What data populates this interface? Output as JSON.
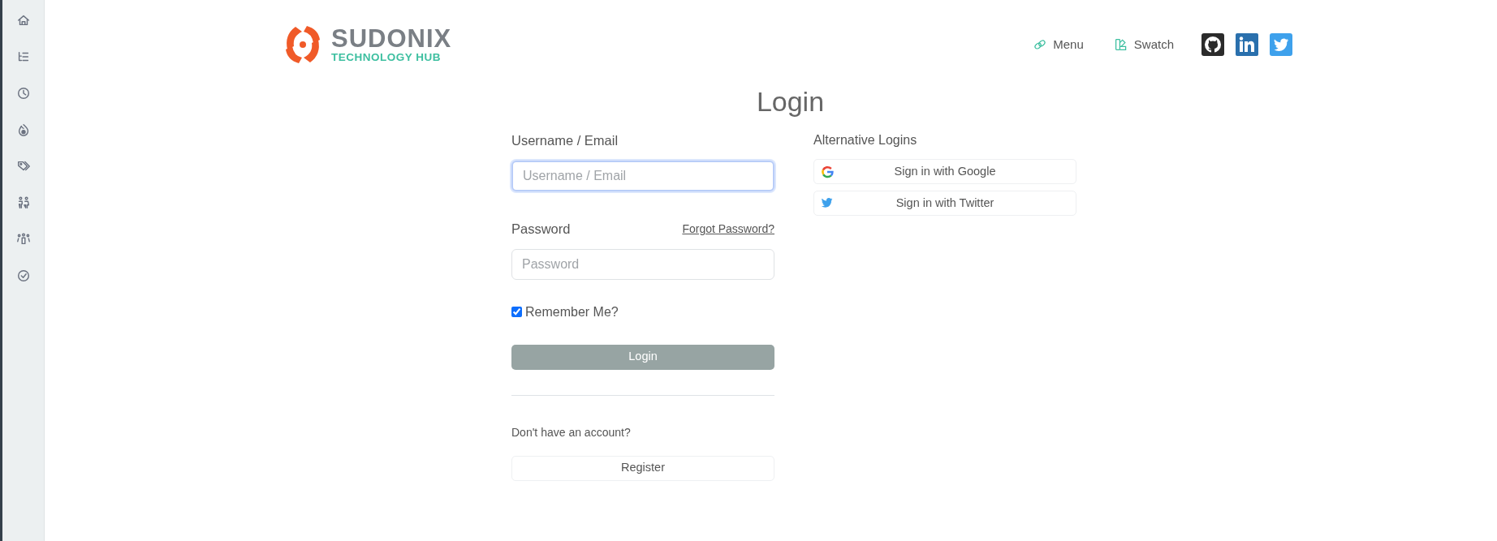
{
  "logo": {
    "name": "SUDONIX",
    "tagline": "TECHNOLOGY HUB"
  },
  "nav": [
    {
      "label": "Menu",
      "kind": "link"
    },
    {
      "label": "Swatch",
      "kind": "swatch"
    }
  ],
  "social": [
    {
      "kind": "github"
    },
    {
      "kind": "linkedin"
    },
    {
      "kind": "twitter"
    }
  ],
  "title": "Login",
  "username": {
    "label": "Username / Email",
    "placeholder": "Username / Email",
    "focused": true
  },
  "password": {
    "label": "Password",
    "placeholder": "Password",
    "focused": false,
    "forgot_link": "Forgot Password?"
  },
  "remember": {
    "label": "Remember Me?",
    "checked": true
  },
  "login_button": "Login",
  "register_prompt": "Don't have an account?",
  "register_button": "Register",
  "alternative": {
    "heading": "Alternative Logins",
    "buttons": [
      {
        "label": "Sign in with Google",
        "kind": "google"
      },
      {
        "label": "Sign in with Twitter",
        "kind": "twitter"
      }
    ]
  }
}
